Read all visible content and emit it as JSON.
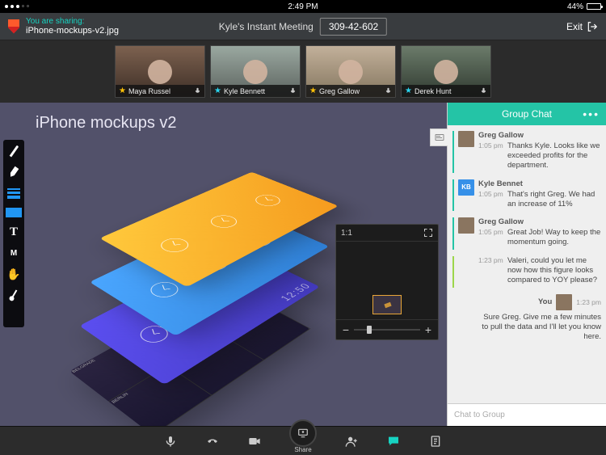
{
  "status": {
    "time": "2:49 PM",
    "battery": "44%"
  },
  "header": {
    "sharing_label": "You are sharing:",
    "sharing_file": "iPhone-mockups-v2.jpg",
    "meeting_title": "Kyle's  Instant Meeting",
    "meeting_id": "309-42-602",
    "exit": "Exit"
  },
  "participants": [
    {
      "name": "Maya Russel",
      "starred": "gold"
    },
    {
      "name": "Kyle Bennett",
      "starred": "blue"
    },
    {
      "name": "Greg Gallow",
      "starred": "gold"
    },
    {
      "name": "Derek Hunt",
      "starred": "blue"
    }
  ],
  "canvas": {
    "title": "iPhone mockups v2",
    "clock_digital": "12:50",
    "minimap": {
      "ratio": "1:1"
    },
    "tools": [
      {
        "id": "pen"
      },
      {
        "id": "highlighter"
      },
      {
        "id": "line-weight"
      },
      {
        "id": "color"
      },
      {
        "id": "text",
        "label": "T"
      },
      {
        "id": "m-tool",
        "label": "M"
      },
      {
        "id": "hand"
      },
      {
        "id": "pointer"
      },
      {
        "id": "eraser"
      }
    ]
  },
  "chat": {
    "title": "Group Chat",
    "placeholder": "Chat to Group",
    "you_label": "You",
    "messages": [
      {
        "author": "Greg Gallow",
        "avatar": "img",
        "entries": [
          {
            "time": "1:05 pm",
            "text": "Thanks Kyle. Looks like we exceeded profits for the department."
          }
        ]
      },
      {
        "author": "Kyle Bennet",
        "avatar": "KB",
        "entries": [
          {
            "time": "1:05 pm",
            "text": "That's right Greg. We had an increase of 11%"
          }
        ]
      },
      {
        "author": "Greg Gallow",
        "avatar": "img",
        "entries": [
          {
            "time": "1:05 pm",
            "text": "Great Job! Way to keep the momentum going."
          },
          {
            "time": "1:23 pm",
            "text": "Valeri, could you let me now how this figure looks compared to YOY please?",
            "stripe": "lime"
          }
        ]
      },
      {
        "author": "You",
        "self": true,
        "entries": [
          {
            "time": "1:23 pm",
            "text": "Sure Greg. Give me a few minutes to pull the data and I'll let you know here."
          }
        ]
      }
    ]
  },
  "bottom": {
    "share_label": "Share"
  }
}
